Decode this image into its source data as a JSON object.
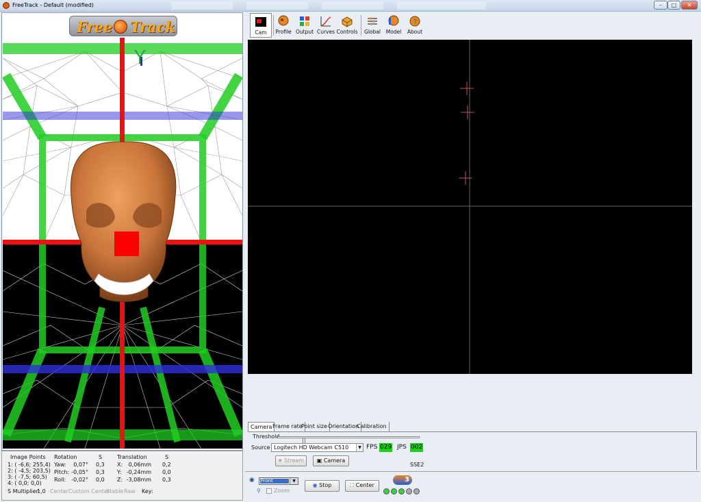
{
  "window": {
    "title": "FreeTrack - Default  (modified)"
  },
  "logo": {
    "left": "Free",
    "right": "Track"
  },
  "toolbar": {
    "buttons": [
      "Cam",
      "Profile",
      "Output",
      "Curves",
      "Controls",
      "Global",
      "Model",
      "About"
    ]
  },
  "scene": {
    "axis_label": "Y"
  },
  "info": {
    "image_points": {
      "header": "Image Points",
      "rows": [
        "1: (   -6,6;  255,4)",
        "2: (   -4,5;  203,5)",
        "3: (   -7,5;    60,5)",
        "4: (    0,0;      0,0)"
      ]
    },
    "rotation": {
      "header": "Rotation",
      "s_header": "S",
      "labels": [
        "Yaw:",
        "Pitch:",
        "Roll:"
      ],
      "values": [
        "0,07°",
        "-0,05°",
        "-0,02°"
      ],
      "s_values": [
        "0,3",
        "0,3",
        "0,0"
      ]
    },
    "translation": {
      "header": "Translation",
      "s_header": "S",
      "labels": [
        "X:",
        "Y:",
        "Z:"
      ],
      "values": [
        "0,06mm",
        "-0,24mm",
        "-3,08mm"
      ],
      "s_values": [
        "0,2",
        "0,0",
        "0,3"
      ]
    },
    "s_multiplier": {
      "label": "S Multiplier:",
      "value": "1,0"
    },
    "links": [
      "Center",
      "Custom Center",
      "Stable",
      "Raw"
    ],
    "key_label": "Key:"
  },
  "settings": {
    "tabs": [
      "Camera",
      "Frame rate",
      "Point size",
      "Orientation",
      "Calibration"
    ],
    "threshold_label": "Threshold",
    "threshold_level": 0.18,
    "source_label": "Source",
    "source_value": "Logitech HD Webcam C510",
    "fps_label": "FPS",
    "fps_value": "029",
    "jps_label": "JPS",
    "jps_value": "002",
    "stream_button": "Stream",
    "camera_button": "Camera",
    "sse_label": "SSE2"
  },
  "bottom": {
    "view_select": "Front",
    "zoom_label": "Zoom",
    "stop_button": "Stop",
    "center_button": "Center",
    "version_badge": "3"
  },
  "colors": {
    "accent_green": "#19d119",
    "skull": "#c8743a",
    "axis_red": "#ee1111",
    "axis_green": "#22cc22",
    "axis_blue": "#3030dd"
  }
}
